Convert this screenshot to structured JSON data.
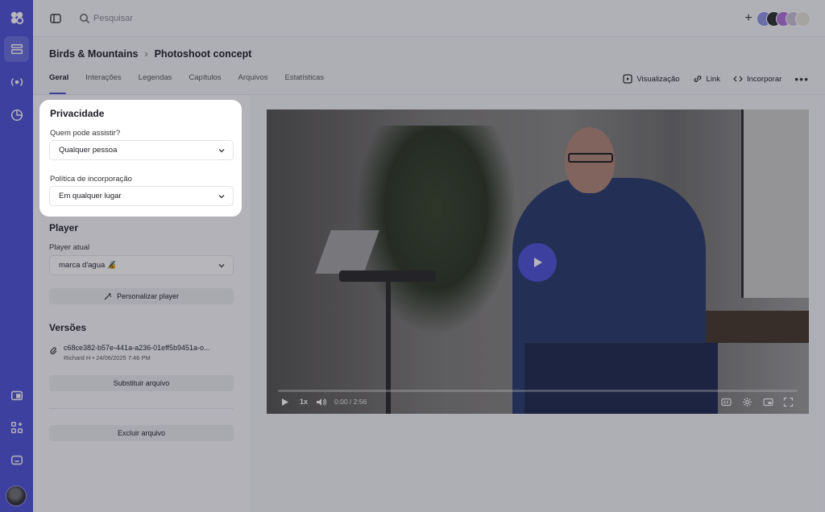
{
  "topbar": {
    "search_placeholder": "Pesquisar",
    "add_label": "+"
  },
  "breadcrumb": {
    "project": "Birds & Mountains",
    "separator": "›",
    "video": "Photoshoot concept"
  },
  "tabs": [
    {
      "label": "Geral",
      "active": true
    },
    {
      "label": "Interações"
    },
    {
      "label": "Legendas"
    },
    {
      "label": "Capítulos"
    },
    {
      "label": "Arquivos"
    },
    {
      "label": "Estatísticas"
    }
  ],
  "actions": {
    "preview": "Visualização",
    "link": "Link",
    "embed": "Incorporar",
    "more": "•••"
  },
  "privacy": {
    "title": "Privacidade",
    "who_label": "Quem pode assistir?",
    "who_value": "Qualquer pessoa",
    "embed_label": "Política de incorporação",
    "embed_value": "Em qualquer lugar"
  },
  "player": {
    "title": "Player",
    "current_label": "Player atual",
    "current_value": "marca d'agua 🔏",
    "customize_label": "Personalizar player"
  },
  "versions": {
    "title": "Versões",
    "file_name": "c68ce382-b57e-441a-a236-01eff5b9451a-o...",
    "file_meta": "Richard H • 24/06/2025 7:46 PM",
    "replace_label": "Substituir arquivo",
    "delete_label": "Excluir arquivo"
  },
  "video": {
    "speed": "1x",
    "time": "0:00 / 2:56",
    "progress": 0
  },
  "colors": {
    "accent": "#4b4fd6",
    "sidebar": "#4b4fd6"
  }
}
